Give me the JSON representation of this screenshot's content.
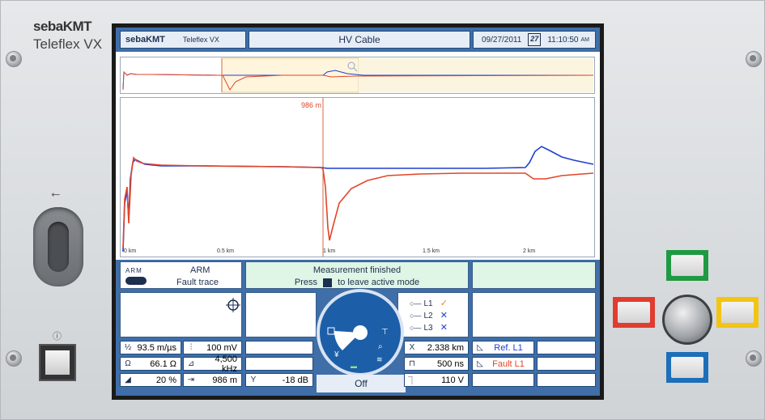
{
  "brand": {
    "logo": "sebaKMT",
    "model": "Teleflex VX"
  },
  "panel_labels": {
    "usb": "⭠",
    "power": "ⓘ"
  },
  "header": {
    "logo": "sebaKMT",
    "product": "Teleflex VX",
    "title": "HV Cable",
    "date": "09/27/2011",
    "calendar_day": "27",
    "time": "11:10:50",
    "time_suffix": "AM"
  },
  "trace": {
    "cursor_label": "986 m",
    "axis_ticks": [
      "0 km",
      "0.5 km",
      "1 km",
      "1.5 km",
      "2 km"
    ],
    "colors": {
      "ref": "#1f3fd0",
      "fault": "#e2452a",
      "cursor": "#d36a4a"
    }
  },
  "mode": {
    "arm_badge": "ARM",
    "title": "ARM",
    "subtitle": "Fault trace"
  },
  "message": {
    "line1": "Measurement finished",
    "line2_prefix": "Press",
    "line2_suffix": "to leave active mode"
  },
  "lines": [
    {
      "label": "L1",
      "state": "✓"
    },
    {
      "label": "L2",
      "state": "✕"
    },
    {
      "label": "L3",
      "state": "✕"
    }
  ],
  "params_left": [
    {
      "icon": "v/2",
      "value": "93.5 m/µs"
    },
    {
      "icon": "R",
      "value": "66.1 Ω"
    },
    {
      "icon": "gain",
      "value": "20 %"
    }
  ],
  "params_mid": [
    {
      "icon": "amp",
      "value": "100 mV"
    },
    {
      "icon": "freq",
      "value": "4,500 kHz"
    },
    {
      "icon": "cursor",
      "value": "986 m"
    },
    {
      "icon": "Y",
      "value": "-18 dB"
    }
  ],
  "params_right": [
    {
      "icon": "X",
      "value": "2.338 km"
    },
    {
      "icon": "pulse",
      "value": "500 ns"
    },
    {
      "icon": "voltage",
      "value": "110 V"
    }
  ],
  "trace_labels": {
    "ref": "Ref. L1",
    "fault": "Fault L1"
  },
  "dial": {
    "off_label": "Off"
  },
  "nav_colors": {
    "green": "#1f9a43",
    "red": "#e03c2f",
    "yellow": "#f2c514",
    "blue": "#1c6fb8"
  }
}
